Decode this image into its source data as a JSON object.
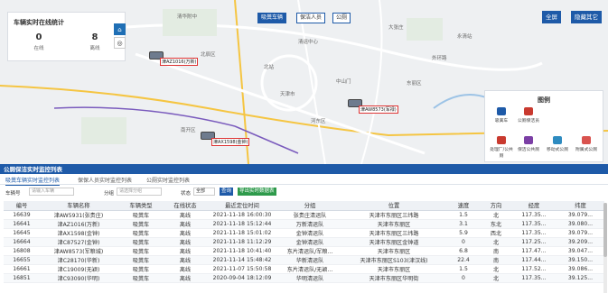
{
  "stats": {
    "title": "车辆实时在线统计",
    "online_value": "0",
    "online_label": "在线",
    "offline_value": "8",
    "offline_label": "离线"
  },
  "map_controls": {
    "vehicle": "吸粪车辆",
    "crew": "保洁人员",
    "toilet": "公厕",
    "fullscreen": "全屏",
    "hide": "隐藏其它"
  },
  "map_labels": [
    "清华附中",
    "清运中心",
    "天津市",
    "北辰区",
    "东丽区",
    "永清站",
    "大张庄",
    "外环路",
    "中山门",
    "北站",
    "河东区",
    "南开区"
  ],
  "vehicles": [
    {
      "plate": "津AZ1016(万新)"
    },
    {
      "plate": "津AW8573(军禄)"
    },
    {
      "plate": "津AX1598(金钟)"
    }
  ],
  "legend": {
    "title": "图例",
    "items": [
      "吸粪车",
      "公厕保洁员",
      "处理厂/公共厕",
      "保洁公共厕",
      "移动式公厕",
      "附属式公厕"
    ]
  },
  "panel": {
    "title": "公厕保洁实时监控列表"
  },
  "tabs": [
    "吸粪车辆实时监控列表",
    "保保人员实时监控列表",
    "公厕实时监控列表"
  ],
  "filters": {
    "plate_label": "车辆号",
    "plate_placeholder": "请输入车辆",
    "group_label": "分组",
    "group_placeholder": "请选择分组",
    "status_label": "状态",
    "status_value": "全部",
    "query": "查询",
    "export": "导出实时数据表"
  },
  "table": {
    "columns": [
      "编号",
      "车辆名称",
      "车辆类型",
      "在线状态",
      "最近定位时间",
      "分组",
      "位置",
      "速度",
      "方向",
      "经度",
      "纬度"
    ],
    "rows": [
      [
        "16639",
        "津AW5931(张贵庄)",
        "吸粪车",
        "离线",
        "2021-11-18 16:00:30",
        "张贵庄清运队",
        "天津市东丽区三纬路",
        "1.5",
        "北",
        "117.35...",
        "39.079..."
      ],
      [
        "16641",
        "津AZ1016(万新)",
        "吸粪车",
        "离线",
        "2021-11-18 15:12:44",
        "万新清运队",
        "天津市东丽区",
        "3.1",
        "东北",
        "117.35...",
        "39.080..."
      ],
      [
        "16645",
        "津AX1598(金钟)",
        "吸粪车",
        "离线",
        "2021-11-18 15:01:02",
        "金钟清运队",
        "天津市东丽区三纬路",
        "5.9",
        "西北",
        "117.35...",
        "39.079..."
      ],
      [
        "16664",
        "津C87527(金钟)",
        "吸粪车",
        "离线",
        "2021-11-18 11:12:29",
        "金钟清运队",
        "天津市东丽区金钟道",
        "0",
        "北",
        "117.25...",
        "39.209..."
      ],
      [
        "16808",
        "津AW8573(军粮城)",
        "吸粪车",
        "离线",
        "2021-11-18 10:41:40",
        "东片清运队/军粮...",
        "天津市东丽区",
        "6.8",
        "南",
        "117.47...",
        "39.047..."
      ],
      [
        "16655",
        "津C28170(华新)",
        "吸粪车",
        "离线",
        "2021-11-14 15:48:42",
        "华新清运队",
        "天津市东丽区S103(津汉线)",
        "22.4",
        "南",
        "117.44...",
        "39.150..."
      ],
      [
        "16661",
        "津C19009(无颖)",
        "吸粪车",
        "离线",
        "2021-11-07 15:50:58",
        "东片清运队/无颖...",
        "天津市东丽区",
        "1.5",
        "北",
        "117.52...",
        "39.086..."
      ],
      [
        "16851",
        "津C93090(华明)",
        "吸粪车",
        "离线",
        "2020-09-04 18:12:09",
        "华明清运队",
        "天津市东丽区华明街",
        "0",
        "北",
        "117.35...",
        "39.125..."
      ]
    ]
  }
}
